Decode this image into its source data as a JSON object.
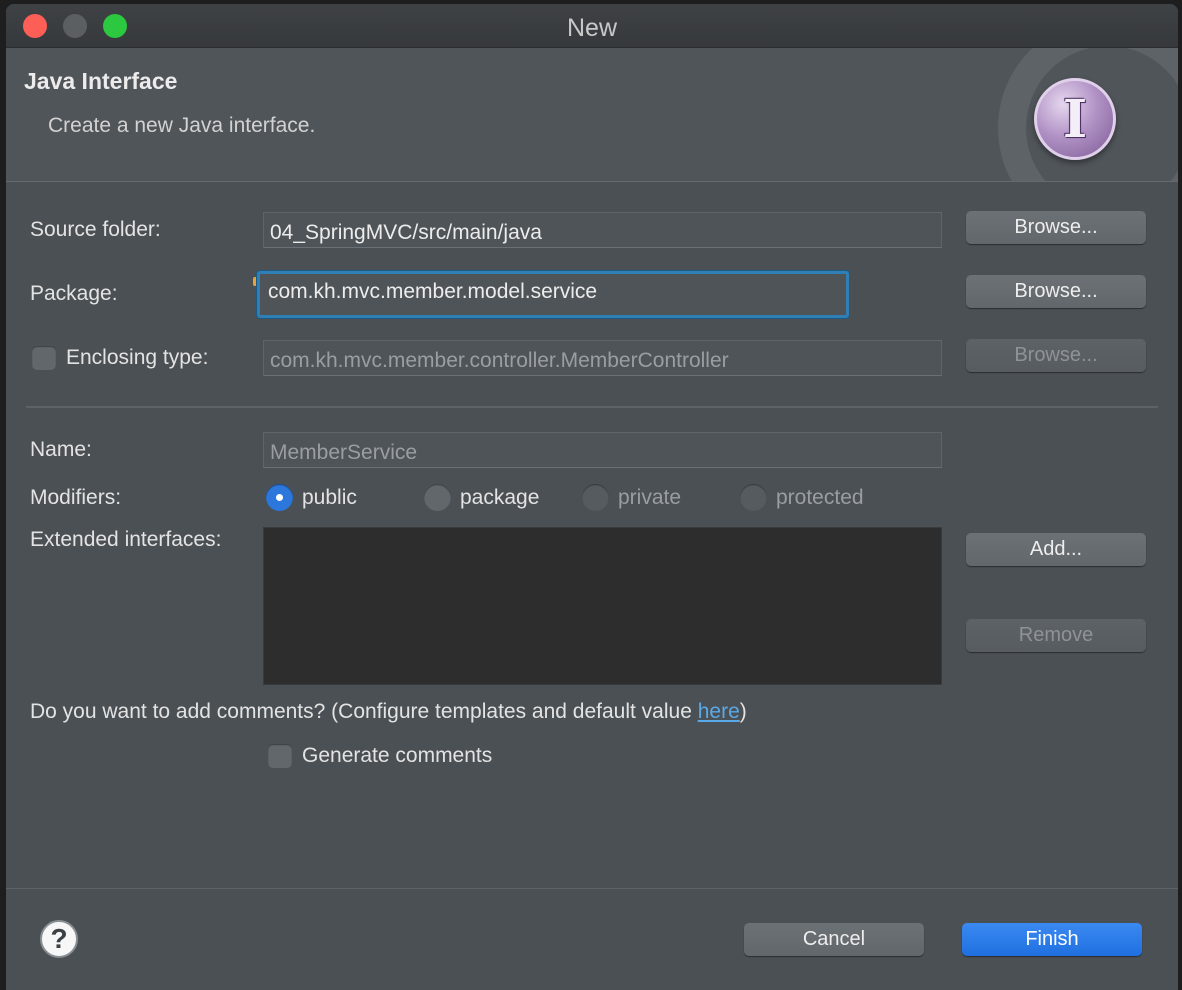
{
  "window": {
    "title": "New"
  },
  "header": {
    "title": "Java Interface",
    "description": "Create a new Java interface."
  },
  "source_folder": {
    "label": "Source folder:",
    "value": "04_SpringMVC/src/main/java",
    "browse_label": "Browse..."
  },
  "package": {
    "label": "Package:",
    "value": "com.kh.mvc.member.model.service",
    "browse_label": "Browse..."
  },
  "enclosing_type": {
    "label": "Enclosing type:",
    "value": "com.kh.mvc.member.controller.MemberController",
    "browse_label": "Browse..."
  },
  "name": {
    "label": "Name:",
    "value": "MemberService"
  },
  "modifiers": {
    "label": "Modifiers:",
    "options": [
      "public",
      "package",
      "private",
      "protected"
    ],
    "selected": "public"
  },
  "extended_interfaces": {
    "label": "Extended interfaces:",
    "add_label": "Add...",
    "remove_label": "Remove"
  },
  "comments": {
    "question_prefix": "Do you want to add comments? (Configure templates and default value ",
    "link": "here",
    "question_suffix": ")",
    "generate_label": "Generate comments"
  },
  "footer": {
    "help_label": "?",
    "cancel_label": "Cancel",
    "finish_label": "Finish"
  },
  "colors": {
    "accent": "#2b77dc",
    "primary_button": "#1f6fe0",
    "link": "#5aa9e6",
    "focus_ring": "#2f7fb5"
  }
}
